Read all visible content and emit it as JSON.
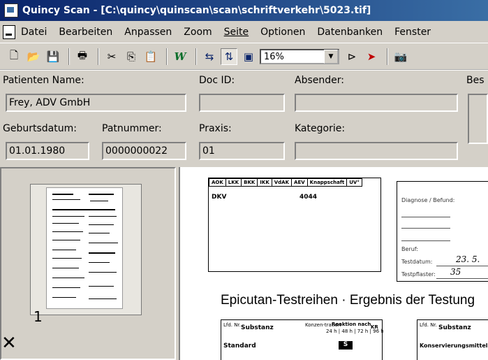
{
  "window": {
    "title": "Quincy Scan - [C:\\quincy\\quinscan\\scan\\schriftverkehr\\5023.tif]"
  },
  "menu": {
    "items": [
      "Datei",
      "Bearbeiten",
      "Anpassen",
      "Zoom",
      "Seite",
      "Optionen",
      "Datenbanken",
      "Fenster"
    ]
  },
  "toolbar": {
    "zoom_value": "16%",
    "icons": [
      "new-icon",
      "open-folder-icon",
      "save-icon",
      "print-icon",
      "cut-icon",
      "copy-icon",
      "paste-icon",
      "w-icon",
      "fit-width-icon",
      "fit-height-icon",
      "fit-page-icon",
      "next-page-icon",
      "next-doc-icon",
      "camera-icon"
    ]
  },
  "form": {
    "patient_name_label": "Patienten Name:",
    "patient_name_value": "Frey, ADV GmbH",
    "doc_id_label": "Doc ID:",
    "doc_id_value": "",
    "absender_label": "Absender:",
    "absender_value": "",
    "bes_label": "Bes",
    "geburtsdatum_label": "Geburtsdatum:",
    "geburtsdatum_value": "01.01.1980",
    "patnummer_label": "Patnummer:",
    "patnummer_value": "0000000022",
    "praxis_label": "Praxis:",
    "praxis_value": "01",
    "kategorie_label": "Kategorie:",
    "kategorie_value": ""
  },
  "thumbnails": {
    "page_number": "1"
  },
  "document": {
    "insurers": [
      "AOK",
      "LKK",
      "BKK",
      "IKK",
      "VdAK",
      "AEV",
      "Knappschaft",
      "UV°"
    ],
    "insurer_name": "DKV",
    "insurer_number": "4044",
    "diagnose_label": "Diagnose / Befund:",
    "beruf_label": "Beruf:",
    "testdatum_label": "Testdatum:",
    "testdatum_value": "23. 5.",
    "testpflaster_label": "Testpflaster:",
    "testpflaster_value": "35",
    "heading": "Epicutan-Testreihen · Ergebnis der Testung",
    "table_headers": [
      "Lfd. Nr.",
      "Substanz",
      "Konzen-tration",
      "Reaktion nach",
      "KR"
    ],
    "reaktion_times": "24 h | 48 h | 72 h | 96 h",
    "section_standard": "Standard",
    "section_s": "S",
    "table2_headers": [
      "Lfd. Nr.",
      "Substanz"
    ],
    "section_konserv": "Konservierungsmittel"
  }
}
